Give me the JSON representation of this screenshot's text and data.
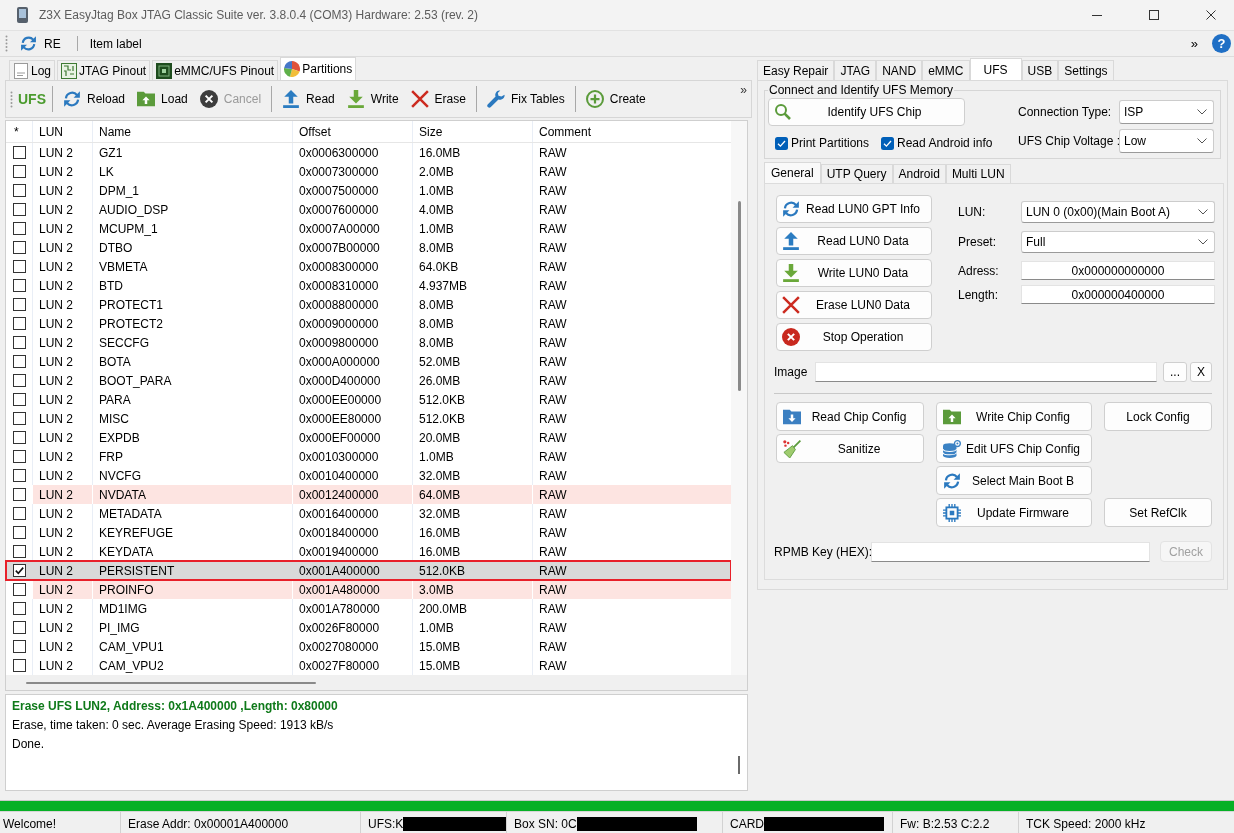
{
  "window": {
    "title": "Z3X EasyJtag Box JTAG Classic Suite ver. 3.8.0.4 (COM3) Hardware: 2.53 (rev. 2)"
  },
  "top_toolbar": {
    "button": "RE",
    "label": "Item label",
    "overflow": "»",
    "help": "?"
  },
  "left_panel": {
    "tabs": [
      {
        "label": "Log",
        "selected": false
      },
      {
        "label": "JTAG Pinout",
        "selected": false
      },
      {
        "label": "eMMC/UFS Pinout",
        "selected": false
      },
      {
        "label": "Partitions",
        "selected": true
      }
    ],
    "toolbar": {
      "title": "UFS",
      "groups": [
        [
          {
            "label": "Reload",
            "disabled": false
          },
          {
            "label": "Load",
            "disabled": false
          },
          {
            "label": "Cancel",
            "disabled": true
          }
        ],
        [
          {
            "label": "Read",
            "disabled": false
          },
          {
            "label": "Write",
            "disabled": false
          },
          {
            "label": "Erase",
            "disabled": false
          }
        ],
        [
          {
            "label": "Fix Tables",
            "disabled": false
          }
        ],
        [
          {
            "label": "Create",
            "disabled": false
          }
        ]
      ],
      "overflow": "»"
    },
    "table": {
      "checkbox_column": "*",
      "columns": [
        "LUN",
        "Name",
        "Offset",
        "Size",
        "Comment"
      ],
      "rows": [
        {
          "checked": false,
          "selected": false,
          "highlighted": false,
          "cells": [
            "LUN 2",
            "GZ1",
            "0x0006300000",
            "16.0MB",
            "RAW"
          ]
        },
        {
          "checked": false,
          "selected": false,
          "highlighted": false,
          "cells": [
            "LUN 2",
            "LK",
            "0x0007300000",
            "2.0MB",
            "RAW"
          ]
        },
        {
          "checked": false,
          "selected": false,
          "highlighted": false,
          "cells": [
            "LUN 2",
            "DPM_1",
            "0x0007500000",
            "1.0MB",
            "RAW"
          ]
        },
        {
          "checked": false,
          "selected": false,
          "highlighted": false,
          "cells": [
            "LUN 2",
            "AUDIO_DSP",
            "0x0007600000",
            "4.0MB",
            "RAW"
          ]
        },
        {
          "checked": false,
          "selected": false,
          "highlighted": false,
          "cells": [
            "LUN 2",
            "MCUPM_1",
            "0x0007A00000",
            "1.0MB",
            "RAW"
          ]
        },
        {
          "checked": false,
          "selected": false,
          "highlighted": false,
          "cells": [
            "LUN 2",
            "DTBO",
            "0x0007B00000",
            "8.0MB",
            "RAW"
          ]
        },
        {
          "checked": false,
          "selected": false,
          "highlighted": false,
          "cells": [
            "LUN 2",
            "VBMETA",
            "0x0008300000",
            "64.0KB",
            "RAW"
          ]
        },
        {
          "checked": false,
          "selected": false,
          "highlighted": false,
          "cells": [
            "LUN 2",
            "BTD",
            "0x0008310000",
            "4.937MB",
            "RAW"
          ]
        },
        {
          "checked": false,
          "selected": false,
          "highlighted": false,
          "cells": [
            "LUN 2",
            "PROTECT1",
            "0x0008800000",
            "8.0MB",
            "RAW"
          ]
        },
        {
          "checked": false,
          "selected": false,
          "highlighted": false,
          "cells": [
            "LUN 2",
            "PROTECT2",
            "0x0009000000",
            "8.0MB",
            "RAW"
          ]
        },
        {
          "checked": false,
          "selected": false,
          "highlighted": false,
          "cells": [
            "LUN 2",
            "SECCFG",
            "0x0009800000",
            "8.0MB",
            "RAW"
          ]
        },
        {
          "checked": false,
          "selected": false,
          "highlighted": false,
          "cells": [
            "LUN 2",
            "BOTA",
            "0x000A000000",
            "52.0MB",
            "RAW"
          ]
        },
        {
          "checked": false,
          "selected": false,
          "highlighted": false,
          "cells": [
            "LUN 2",
            "BOOT_PARA",
            "0x000D400000",
            "26.0MB",
            "RAW"
          ]
        },
        {
          "checked": false,
          "selected": false,
          "highlighted": false,
          "cells": [
            "LUN 2",
            "PARA",
            "0x000EE00000",
            "512.0KB",
            "RAW"
          ]
        },
        {
          "checked": false,
          "selected": false,
          "highlighted": false,
          "cells": [
            "LUN 2",
            "MISC",
            "0x000EE80000",
            "512.0KB",
            "RAW"
          ]
        },
        {
          "checked": false,
          "selected": false,
          "highlighted": false,
          "cells": [
            "LUN 2",
            "EXPDB",
            "0x000EF00000",
            "20.0MB",
            "RAW"
          ]
        },
        {
          "checked": false,
          "selected": false,
          "highlighted": false,
          "cells": [
            "LUN 2",
            "FRP",
            "0x0010300000",
            "1.0MB",
            "RAW"
          ]
        },
        {
          "checked": false,
          "selected": false,
          "highlighted": false,
          "cells": [
            "LUN 2",
            "NVCFG",
            "0x0010400000",
            "32.0MB",
            "RAW"
          ]
        },
        {
          "checked": false,
          "selected": false,
          "highlighted": true,
          "cells": [
            "LUN 2",
            "NVDATA",
            "0x0012400000",
            "64.0MB",
            "RAW"
          ]
        },
        {
          "checked": false,
          "selected": false,
          "highlighted": false,
          "cells": [
            "LUN 2",
            "METADATA",
            "0x0016400000",
            "32.0MB",
            "RAW"
          ]
        },
        {
          "checked": false,
          "selected": false,
          "highlighted": false,
          "cells": [
            "LUN 2",
            "KEYREFUGE",
            "0x0018400000",
            "16.0MB",
            "RAW"
          ]
        },
        {
          "checked": false,
          "selected": false,
          "highlighted": false,
          "cells": [
            "LUN 2",
            "KEYDATA",
            "0x0019400000",
            "16.0MB",
            "RAW"
          ]
        },
        {
          "checked": true,
          "selected": true,
          "highlighted": false,
          "cells": [
            "LUN 2",
            "PERSISTENT",
            "0x001A400000",
            "512.0KB",
            "RAW"
          ]
        },
        {
          "checked": false,
          "selected": false,
          "highlighted": true,
          "cells": [
            "LUN 2",
            "PROINFO",
            "0x001A480000",
            "3.0MB",
            "RAW"
          ]
        },
        {
          "checked": false,
          "selected": false,
          "highlighted": false,
          "cells": [
            "LUN 2",
            "MD1IMG",
            "0x001A780000",
            "200.0MB",
            "RAW"
          ]
        },
        {
          "checked": false,
          "selected": false,
          "highlighted": false,
          "cells": [
            "LUN 2",
            "PI_IMG",
            "0x0026F80000",
            "1.0MB",
            "RAW"
          ]
        },
        {
          "checked": false,
          "selected": false,
          "highlighted": false,
          "cells": [
            "LUN 2",
            "CAM_VPU1",
            "0x0027080000",
            "15.0MB",
            "RAW"
          ]
        },
        {
          "checked": false,
          "selected": false,
          "highlighted": false,
          "cells": [
            "LUN 2",
            "CAM_VPU2",
            "0x0027F80000",
            "15.0MB",
            "RAW"
          ]
        }
      ]
    },
    "log": {
      "lines": [
        {
          "text": "Erase UFS LUN2, Address: 0x1A400000 ,Length: 0x80000",
          "kind": "success"
        },
        {
          "text": "Erase, time taken: 0 sec. Average Erasing Speed: 1913 kB/s",
          "kind": "info"
        },
        {
          "text": "Done.",
          "kind": "info"
        }
      ]
    }
  },
  "right_panel": {
    "tabs": [
      {
        "label": "Easy Repair",
        "selected": false
      },
      {
        "label": "JTAG",
        "selected": false
      },
      {
        "label": "NAND",
        "selected": false
      },
      {
        "label": "eMMC",
        "selected": false
      },
      {
        "label": "UFS",
        "selected": true
      },
      {
        "label": "USB",
        "selected": false
      },
      {
        "label": "Settings",
        "selected": false
      }
    ],
    "group_title": "Connect and Identify UFS Memory",
    "identify_button": "Identify UFS Chip",
    "options": [
      {
        "label": "Print Partitions",
        "checked": true
      },
      {
        "label": "Read Android info",
        "checked": true
      }
    ],
    "settings": [
      {
        "label": "Connection Type:",
        "value": "ISP"
      },
      {
        "label": "UFS Chip Voltage :",
        "value": "Low"
      }
    ],
    "sub_tabs": [
      {
        "label": "General",
        "selected": true
      },
      {
        "label": "UTP Query",
        "selected": false
      },
      {
        "label": "Android",
        "selected": false
      },
      {
        "label": "Multi LUN",
        "selected": false
      }
    ],
    "actions": [
      "Read LUN0 GPT Info",
      "Read LUN0 Data",
      "Write LUN0 Data",
      "Erase LUN0 Data",
      "Stop Operation"
    ],
    "form": [
      {
        "label": "LUN:",
        "value": "LUN 0 (0x00)(Main Boot A)",
        "kind": "dropdown"
      },
      {
        "label": "Preset:",
        "value": "Full",
        "kind": "dropdown"
      },
      {
        "label": "Adress:",
        "value": "0x000000000000",
        "kind": "text"
      },
      {
        "label": "Length:",
        "value": "0x000000400000",
        "kind": "text"
      }
    ],
    "image": {
      "label": "Image",
      "browse": "...",
      "clear": "X"
    },
    "config_buttons": [
      "Read Chip Config",
      "Write Chip Config",
      "Lock Config",
      "Sanitize",
      "Edit UFS Chip Config",
      "Select Main Boot B",
      "Update Firmware",
      "Set RefClk"
    ],
    "rpmb": {
      "label": "RPMB Key (HEX):",
      "button": "Check",
      "disabled": true
    }
  },
  "progress": {
    "level": 1
  },
  "status_bar": {
    "fields": [
      {
        "text": "Welcome!",
        "redacted": false
      },
      {
        "text": "Erase Addr: 0x00001A400000",
        "redacted": false
      },
      {
        "text": "UFS:K",
        "redacted": true
      },
      {
        "text": "Box SN: 0C",
        "redacted": true
      },
      {
        "text": "CARD",
        "redacted": true
      },
      {
        "text": "Fw: B:2.53 C:2.2",
        "redacted": false
      },
      {
        "text": "TCK Speed: 2000 kHz",
        "redacted": false
      }
    ]
  }
}
